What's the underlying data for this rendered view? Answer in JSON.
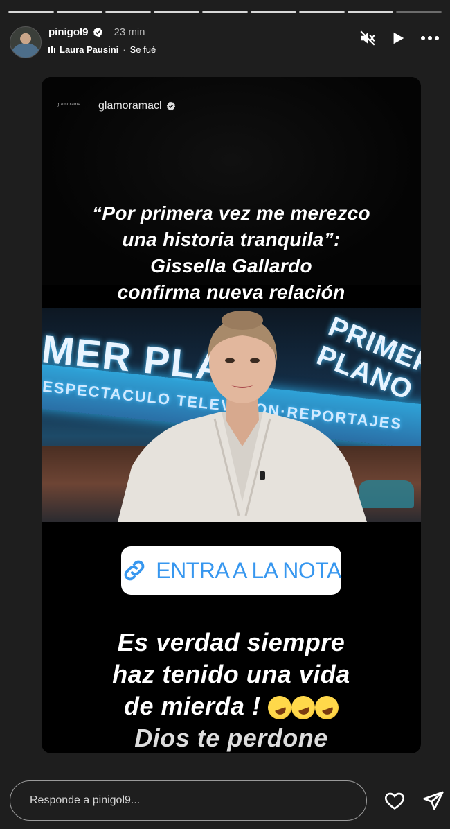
{
  "progress": {
    "segments_total": 9,
    "segments_viewed": 8
  },
  "header": {
    "username": "pinigol9",
    "time": "23 min",
    "music_artist": "Laura Pausini",
    "music_separator": "·",
    "music_song": "Se fué"
  },
  "story": {
    "mini_logo": "glamorama",
    "account": "glamoramacl",
    "headline": [
      "“Por primera vez me merezco",
      "una historia tranquila”:",
      "Gissella Gallardo",
      "confirma nueva relación"
    ],
    "photo_sign_left": "MER PLA",
    "photo_sign_sub": "ESPECTACULO  TELEVISION·REPORTAJES",
    "photo_sign_right": "PRIMER PLANO",
    "link_label": "ENTRA A LA NOTA",
    "caption": [
      "Es verdad siempre",
      "haz tenido una vida",
      "de mierda !",
      "Dios te perdone"
    ],
    "caption_emoji": "🤣🤣🤣"
  },
  "footer": {
    "reply_placeholder": "Responde a pinigol9..."
  },
  "colors": {
    "link": "#3797ef",
    "background": "#1e1e1e"
  }
}
